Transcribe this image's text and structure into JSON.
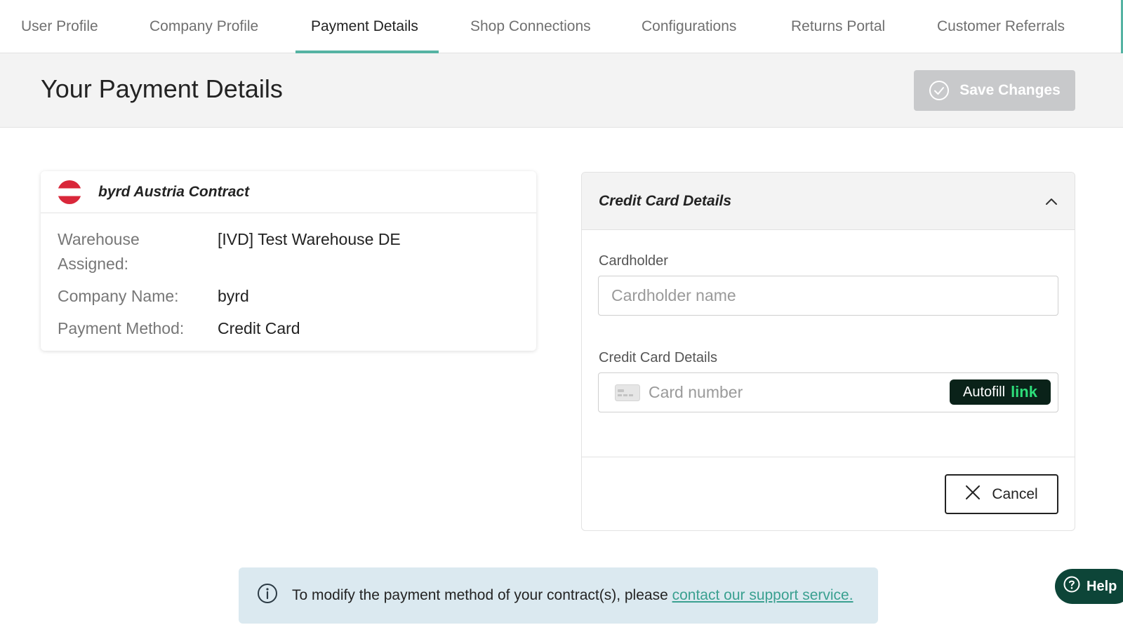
{
  "tabs": [
    {
      "label": "User Profile"
    },
    {
      "label": "Company Profile"
    },
    {
      "label": "Payment Details",
      "active": true
    },
    {
      "label": "Shop Connections"
    },
    {
      "label": "Configurations"
    },
    {
      "label": "Returns Portal"
    },
    {
      "label": "Customer Referrals"
    }
  ],
  "header": {
    "title": "Your Payment Details",
    "save_label": "Save Changes"
  },
  "contract": {
    "title": "byrd Austria Contract",
    "flag_icon": "austria-flag-icon",
    "rows": [
      {
        "label": "Warehouse Assigned:",
        "value": "[IVD] Test Warehouse DE"
      },
      {
        "label": "Company Name:",
        "value": "byrd"
      },
      {
        "label": "Payment Method:",
        "value": "Credit Card"
      }
    ]
  },
  "credit_card": {
    "panel_title": "Credit Card Details",
    "cardholder_label": "Cardholder",
    "cardholder_placeholder": "Cardholder name",
    "details_label": "Credit Card Details",
    "card_number_placeholder": "Card number",
    "autofill_label": "Autofill",
    "autofill_link": "link",
    "cancel_label": "Cancel"
  },
  "info": {
    "text": "To modify the payment method of your contract(s), please ",
    "link_text": "contact our support service."
  },
  "help": {
    "label": "Help"
  },
  "colors": {
    "accent": "#55b3a3",
    "save_disabled": "#c8c9cb",
    "info_bg": "#dbe9f0",
    "help_bg": "#0d4538",
    "autofill_bg": "#0a2219",
    "autofill_link": "#2ede7a"
  }
}
